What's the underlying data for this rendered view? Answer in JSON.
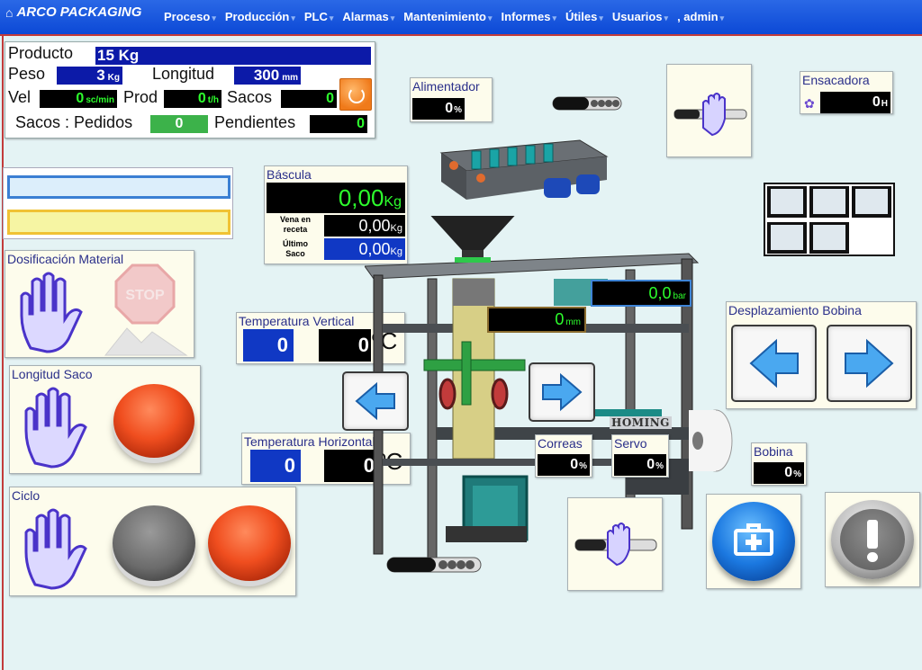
{
  "nav": {
    "brand": "ARCO PACKAGING",
    "menu": [
      "Proceso",
      "Producción",
      "PLC",
      "Alarmas",
      "Mantenimiento",
      "Informes",
      "Útiles",
      "Usuarios",
      ", admin"
    ]
  },
  "product": {
    "producto_label": "Producto",
    "producto_value": "15 Kg",
    "peso_label": "Peso",
    "peso_value": "3",
    "peso_unit": "Kg",
    "longitud_label": "Longitud",
    "longitud_value": "300",
    "longitud_unit": "mm",
    "vel_label": "Vel",
    "vel_value": "0",
    "vel_unit": "sc/min",
    "prod_label": "Prod",
    "prod_value": "0",
    "prod_unit": "t/h",
    "sacos_label": "Sacos",
    "sacos_value": "0",
    "pedidos_label": "Sacos : Pedidos",
    "pedidos_value": "0",
    "pendientes_label": "Pendientes",
    "pendientes_value": "0"
  },
  "alimentador": {
    "title": "Alimentador",
    "value": "0",
    "unit": "%"
  },
  "ensacadora": {
    "title": "Ensacadora",
    "value": "0",
    "unit": "H"
  },
  "bascula": {
    "title": "Báscula",
    "main_value": "0,00",
    "main_unit": "Kg",
    "vena_label_1": "Vena en",
    "vena_label_2": "receta",
    "vena_value": "0,00",
    "vena_unit": "Kg",
    "ultimo_label_1": "Último",
    "ultimo_label_2": "Saco",
    "ultimo_value": "0,00",
    "ultimo_unit": "Kg"
  },
  "dosificacion": {
    "title": "Dosificación Material",
    "stop_text": "STOP"
  },
  "temp_vertical": {
    "title": "Temperatura Vertical",
    "setpoint": "0",
    "actual": "0",
    "unit": "ºC"
  },
  "temp_horizontal": {
    "title": "Temperatura Horizontal",
    "setpoint": "0",
    "actual": "0",
    "unit": "ºC"
  },
  "longitud_saco": {
    "title": "Longitud Saco"
  },
  "ciclo": {
    "title": "Ciclo"
  },
  "pressure": {
    "value": "0,0",
    "unit": "bar"
  },
  "length_mm": {
    "value": "0",
    "unit": "mm"
  },
  "desplazamiento": {
    "title": "Desplazamiento Bobina"
  },
  "correas": {
    "title": "Correas",
    "value": "0",
    "unit": "%"
  },
  "servo": {
    "title": "Servo",
    "value": "0",
    "unit": "%"
  },
  "bobina": {
    "title": "Bobina",
    "value": "0",
    "unit": "%"
  },
  "homing": "HOMING",
  "colors": {
    "nav_blue": "#1553dd",
    "lcd_green": "#2dff2d",
    "panel_bg": "#fdfcec",
    "setpoint_blue": "#1038c4",
    "accent_red": "#f04e1f"
  },
  "icons": [
    "home-icon",
    "refresh-icon",
    "hand-stop-icon",
    "stop-sign-icon",
    "arrow-left-icon",
    "arrow-right-icon",
    "gear-icon",
    "first-aid-icon",
    "warning-icon"
  ]
}
